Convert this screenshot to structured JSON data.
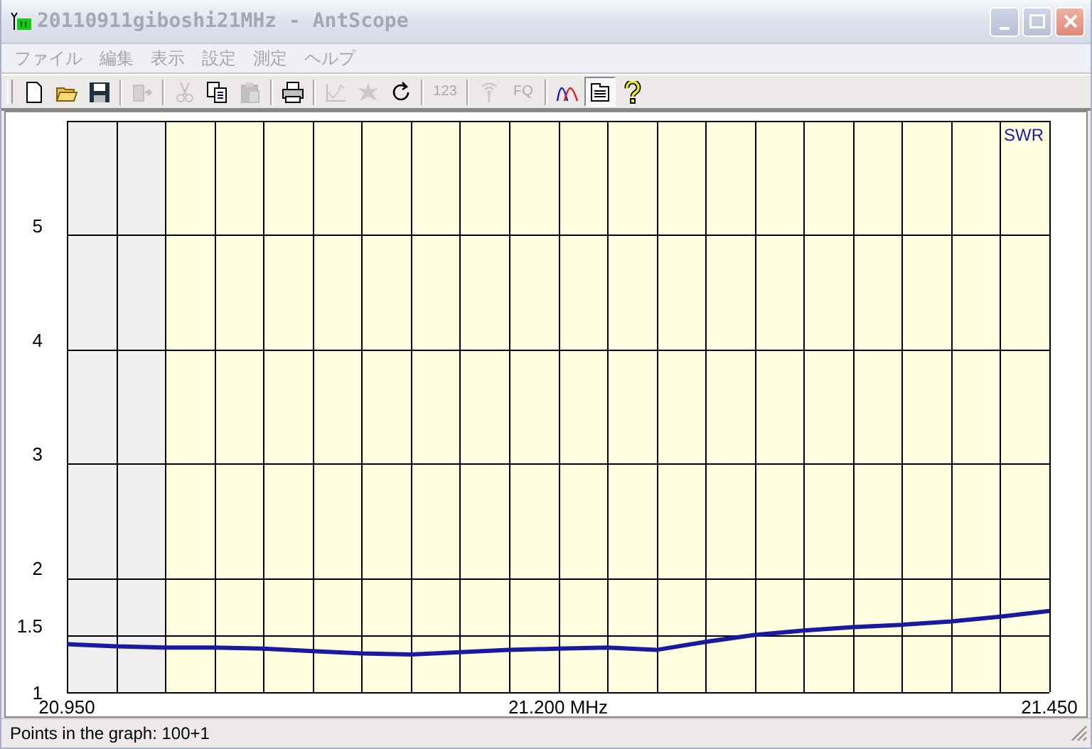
{
  "window": {
    "title": "20110911giboshi21MHz - AntScope",
    "active": false
  },
  "menu": [
    {
      "label": "ファイル"
    },
    {
      "label": "編集"
    },
    {
      "label": "表示"
    },
    {
      "label": "設定"
    },
    {
      "label": "測定"
    },
    {
      "label": "ヘルプ"
    }
  ],
  "toolbar": [
    {
      "kind": "new",
      "disabled": false,
      "pressed": false
    },
    {
      "kind": "open",
      "disabled": false,
      "pressed": false
    },
    {
      "kind": "save",
      "disabled": false,
      "pressed": false
    },
    {
      "kind": "sep"
    },
    {
      "kind": "export",
      "disabled": true,
      "pressed": false
    },
    {
      "kind": "sep"
    },
    {
      "kind": "cut",
      "disabled": true,
      "pressed": false
    },
    {
      "kind": "copy",
      "disabled": false,
      "pressed": false
    },
    {
      "kind": "paste",
      "disabled": true,
      "pressed": false
    },
    {
      "kind": "sep"
    },
    {
      "kind": "print",
      "disabled": false,
      "pressed": false
    },
    {
      "kind": "sep"
    },
    {
      "kind": "chart",
      "disabled": true,
      "pressed": false
    },
    {
      "kind": "star",
      "disabled": true,
      "pressed": false
    },
    {
      "kind": "refresh",
      "disabled": false,
      "pressed": false
    },
    {
      "kind": "sep"
    },
    {
      "kind": "text",
      "label": "123",
      "disabled": true,
      "pressed": false
    },
    {
      "kind": "sep"
    },
    {
      "kind": "antenna",
      "disabled": true,
      "pressed": false
    },
    {
      "kind": "text",
      "label": "FQ",
      "disabled": true,
      "pressed": false
    },
    {
      "kind": "sep"
    },
    {
      "kind": "curves",
      "disabled": false,
      "pressed": false
    },
    {
      "kind": "list",
      "disabled": false,
      "pressed": true
    },
    {
      "kind": "help",
      "disabled": false,
      "pressed": false
    }
  ],
  "graph": {
    "chart_data": {
      "type": "line",
      "x": [
        20.95,
        20.975,
        21.0,
        21.025,
        21.05,
        21.075,
        21.1,
        21.125,
        21.15,
        21.175,
        21.2,
        21.225,
        21.25,
        21.275,
        21.3,
        21.325,
        21.35,
        21.375,
        21.4,
        21.425,
        21.45
      ],
      "series": [
        {
          "name": "SWR",
          "color": "#1a1aa0",
          "values": [
            1.42,
            1.4,
            1.39,
            1.39,
            1.38,
            1.36,
            1.34,
            1.33,
            1.35,
            1.37,
            1.38,
            1.39,
            1.37,
            1.44,
            1.5,
            1.54,
            1.57,
            1.59,
            1.62,
            1.66,
            1.71
          ]
        }
      ],
      "xlim": [
        20.95,
        21.45
      ],
      "ylim": [
        1,
        6
      ],
      "xticks": [
        {
          "value": 20.95,
          "label": "20.950"
        },
        {
          "value": 21.2,
          "label": "21.200 MHz"
        },
        {
          "value": 21.45,
          "label": "21.450"
        }
      ],
      "yticks": [
        1,
        1.5,
        2,
        3,
        4,
        5
      ],
      "grid": true,
      "bands": [
        {
          "axis": "x",
          "from": 20.95,
          "to": 21.0
        }
      ]
    }
  },
  "status_bar": {
    "text": "Points in the graph: 100+1"
  }
}
